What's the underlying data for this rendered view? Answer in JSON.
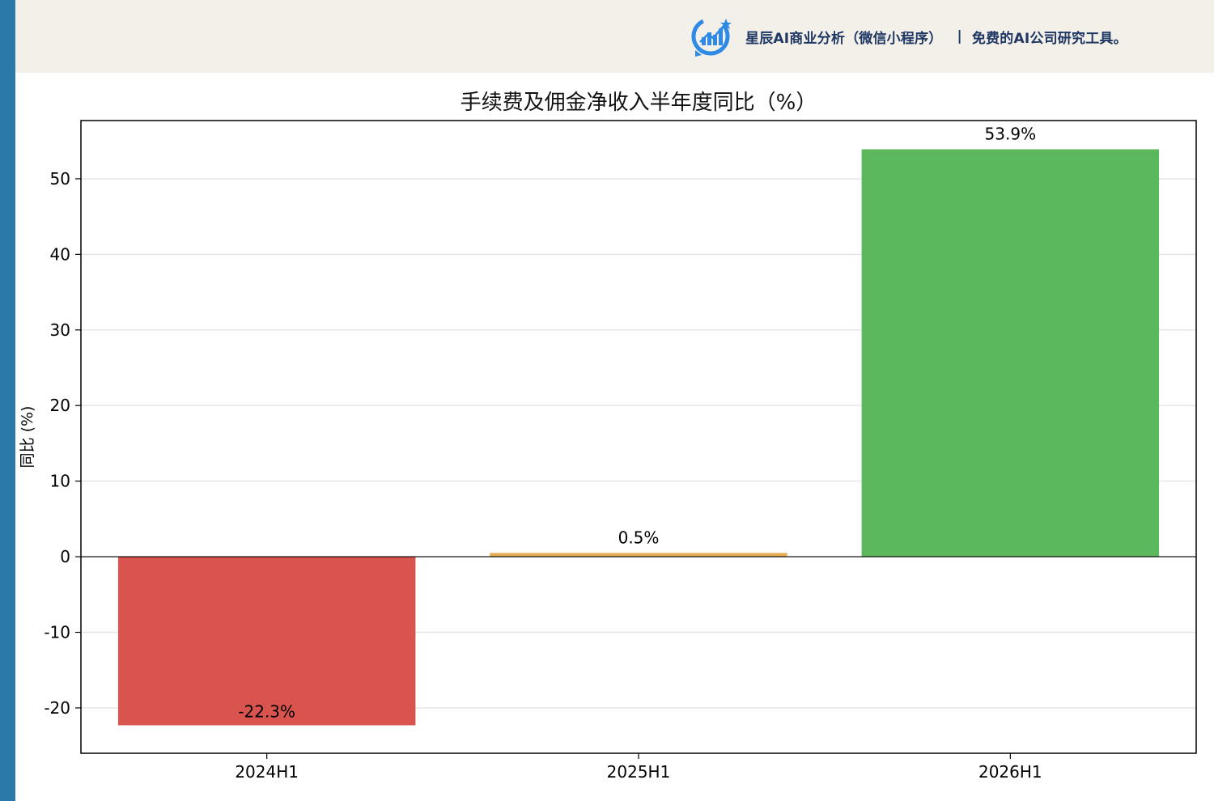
{
  "banner": {
    "brand_name": "星辰AI商业分析（微信小程序）",
    "separator": "|",
    "tagline": "免费的AI公司研究工具。",
    "logo_icon": "bar-chart-circle-icon",
    "text_color": "#1f3763",
    "background": "#f3efe9"
  },
  "chart_data": {
    "type": "bar",
    "title": "手续费及佣金净收入半年度同比（%）",
    "xlabel": "",
    "ylabel": "同比 (%)",
    "categories": [
      "2024H1",
      "2025H1",
      "2026H1"
    ],
    "values": [
      -22.3,
      0.5,
      53.9
    ],
    "value_labels": [
      "-22.3%",
      "0.5%",
      "53.9%"
    ],
    "colors": [
      "#d9534f",
      "#e8ad52",
      "#5cb85c"
    ],
    "ylim": [
      -26,
      57.7
    ],
    "yticks": [
      -20,
      -10,
      0,
      10,
      20,
      30,
      40,
      50
    ],
    "ytick_labels": [
      "-20",
      "-10",
      "0",
      "10",
      "20",
      "30",
      "40",
      "50"
    ],
    "grid": true,
    "legend": "none"
  }
}
